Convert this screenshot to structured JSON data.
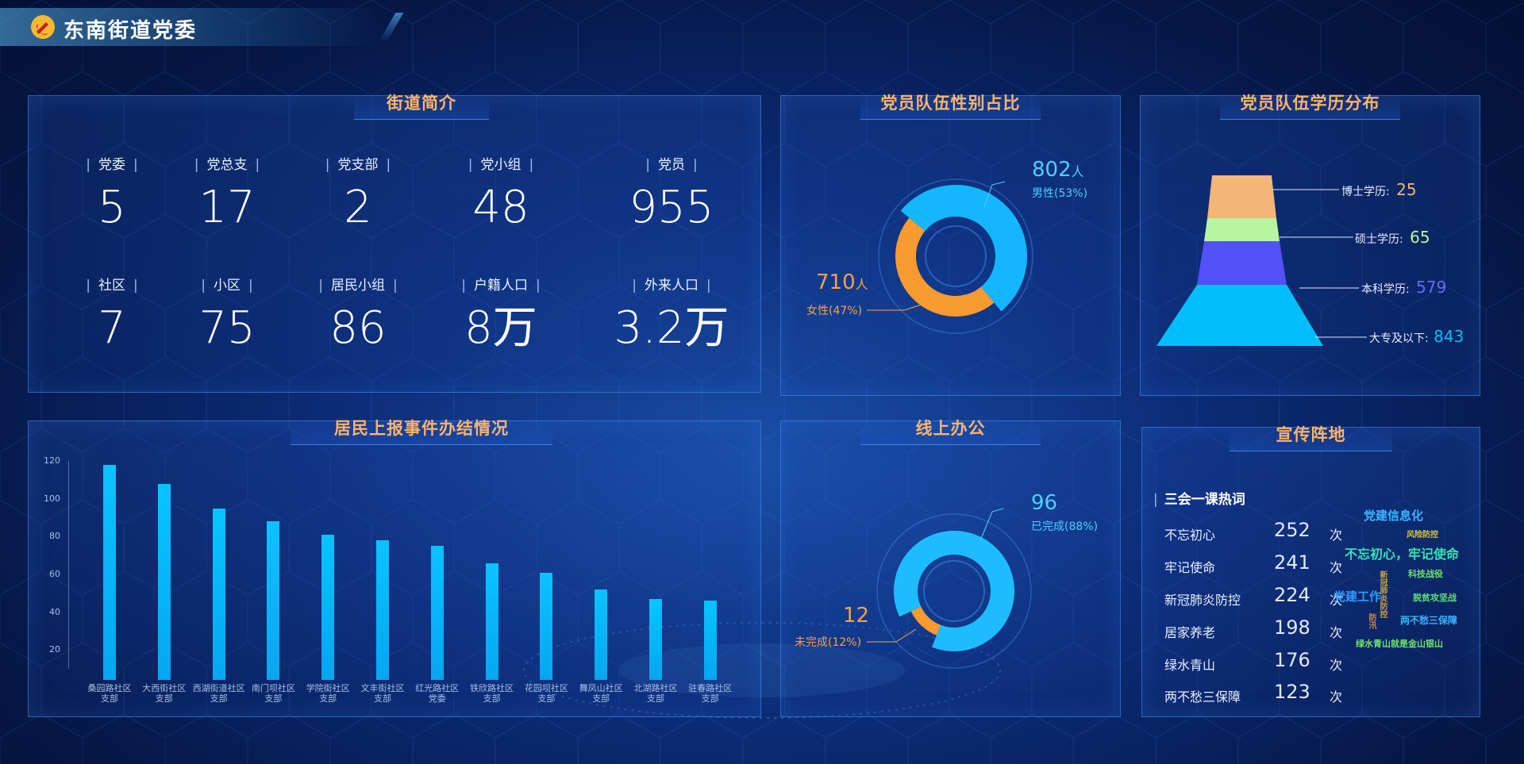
{
  "header": {
    "title": "东南街道党委"
  },
  "intro": {
    "title": "街道简介",
    "row1": [
      {
        "label": "党委",
        "value": "5"
      },
      {
        "label": "党总支",
        "value": "17"
      },
      {
        "label": "党支部",
        "value": "2"
      },
      {
        "label": "党小组",
        "value": "48"
      },
      {
        "label": "党员",
        "value": "955"
      }
    ],
    "row2": [
      {
        "label": "社区",
        "value": "7"
      },
      {
        "label": "小区",
        "value": "75"
      },
      {
        "label": "居民小组",
        "value": "86"
      },
      {
        "label": "户籍人口",
        "value": "8万"
      },
      {
        "label": "外来人口",
        "value": "3.2万"
      }
    ]
  },
  "gender": {
    "title": "党员队伍性别占比",
    "male_value": "802",
    "male_unit": "人",
    "male_label": "男性(53%)",
    "female_value": "710",
    "female_unit": "人",
    "female_label": "女性(47%)",
    "male_fraction": 0.53
  },
  "education": {
    "title": "党员队伍学历分布",
    "levels": [
      {
        "label": "博士学历:",
        "value": "25",
        "color": "#f2b676"
      },
      {
        "label": "硕士学历:",
        "value": "65",
        "color": "#b8f5a0"
      },
      {
        "label": "本科学历:",
        "value": "579",
        "color": "#5151f5"
      },
      {
        "label": "大专及以下:",
        "value": "843",
        "color": "#00bff8"
      }
    ]
  },
  "events": {
    "title": "居民上报事件办结情况",
    "chart_data": {
      "type": "bar",
      "categories": [
        "桑园路社区支部",
        "大西街社区支部",
        "西湖街道社区支部",
        "南门坝社区支部",
        "学院街社区支部",
        "文丰街社区支部",
        "红光路社区党委",
        "铁欣路社区支部",
        "花园坝社区支部",
        "舞凤山社区支部",
        "北湖路社区支部",
        "驻春路社区支部"
      ],
      "values": [
        118,
        108,
        95,
        88,
        81,
        78,
        75,
        66,
        61,
        52,
        47,
        46
      ],
      "y_ticks": [
        20,
        40,
        60,
        80,
        100,
        120
      ],
      "ylim": [
        10,
        120
      ]
    },
    "xlabels": [
      [
        "桑园路社区",
        "支部"
      ],
      [
        "大西街社区",
        "支部"
      ],
      [
        "西湖街道社区",
        "支部"
      ],
      [
        "南门坝社区",
        "支部"
      ],
      [
        "学院街社区",
        "支部"
      ],
      [
        "文丰街社区",
        "支部"
      ],
      [
        "红光路社区",
        "党委"
      ],
      [
        "铁欣路社区",
        "支部"
      ],
      [
        "花园坝社区",
        "支部"
      ],
      [
        "舞凤山社区",
        "支部"
      ],
      [
        "北湖路社区",
        "支部"
      ],
      [
        "驻春路社区",
        "支部"
      ]
    ]
  },
  "office": {
    "title": "线上办公",
    "done_value": "96",
    "done_label": "已完成(88%)",
    "undone_value": "12",
    "undone_label": "未完成(12%)",
    "done_fraction": 0.88
  },
  "publicity": {
    "title": "宣传阵地",
    "subtitle": "三会一课热词",
    "items": [
      {
        "word": "不忘初心",
        "count": "252",
        "unit": "次"
      },
      {
        "word": "牢记使命",
        "count": "241",
        "unit": "次"
      },
      {
        "word": "新冠肺炎防控",
        "count": "224",
        "unit": "次"
      },
      {
        "word": "居家养老",
        "count": "198",
        "unit": "次"
      },
      {
        "word": "绿水青山",
        "count": "176",
        "unit": "次"
      },
      {
        "word": "两不愁三保障",
        "count": "123",
        "unit": "次"
      }
    ],
    "cloud": {
      "w1": "党建信息化",
      "w2": "风险防控",
      "w3": "不忘初心，牢记使命",
      "w4": "科技战役",
      "w5": "党建工作",
      "w6": "新冠肺炎防控",
      "w7": "脱贫攻坚战",
      "w8": "两不愁三保障",
      "w9": "防汛",
      "w10": "绿水青山就是金山银山"
    }
  },
  "colors": {
    "accent": "#ffb46a",
    "cyan": "#0ac3ff",
    "orange": "#f79a30",
    "blue_bg": "#0c2c78"
  }
}
